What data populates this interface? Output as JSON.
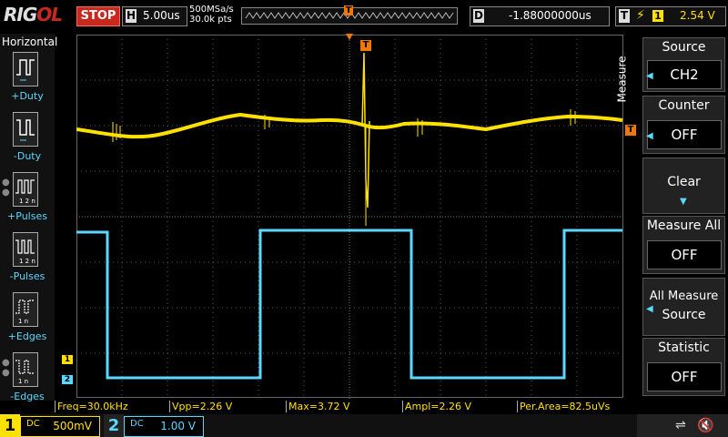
{
  "header": {
    "logo_main": "RIG",
    "logo_accent": "OL",
    "run_state": "STOP",
    "timebase_key": "H",
    "timebase_value": "5.00us",
    "sample_rate": "500MSa/s",
    "memory_depth": "30.0k pts",
    "trigger_marker": "T",
    "delay_key": "D",
    "delay_value": "-1.88000000us",
    "trigger_key": "T",
    "trigger_slope": "⚡",
    "trigger_source": "1",
    "trigger_level": "2.54 V"
  },
  "left_panel": {
    "title": "Horizontal",
    "items": [
      {
        "label": "+Duty",
        "icon": "positive-duty-icon"
      },
      {
        "label": "-Duty",
        "icon": "negative-duty-icon"
      },
      {
        "label": "+Pulses",
        "icon": "positive-pulses-icon"
      },
      {
        "label": "-Pulses",
        "icon": "negative-pulses-icon"
      },
      {
        "label": "+Edges",
        "icon": "positive-edges-icon"
      },
      {
        "label": "-Edges",
        "icon": "negative-edges-icon"
      }
    ]
  },
  "right_panel": {
    "tab_label": "Measure",
    "buttons": [
      {
        "title": "Source",
        "value": "CH2"
      },
      {
        "title": "Counter",
        "value": "OFF"
      },
      {
        "title": "Clear",
        "value": ""
      },
      {
        "title": "Measure All",
        "value": "OFF"
      },
      {
        "title": "All Measure",
        "value": "Source"
      },
      {
        "title": "Statistic",
        "value": "OFF"
      }
    ]
  },
  "markers": {
    "ch1": "1",
    "ch2": "2",
    "trigger_top": "T",
    "trigger_right": "T"
  },
  "measurements": [
    {
      "text": "Freq=30.0kHz"
    },
    {
      "text": "Vpp=2.26 V"
    },
    {
      "text": "Max=3.72 V"
    },
    {
      "text": "Ampl=2.26 V"
    },
    {
      "text": "Per.Area=82.5uVs"
    }
  ],
  "channels": {
    "ch1": {
      "number": "1",
      "coupling": "DC",
      "scale": "500mV",
      "color": "#ffe100"
    },
    "ch2": {
      "number": "2",
      "coupling": "DC",
      "scale": "1.00 V",
      "color": "#5ad8ff"
    }
  },
  "status_icons": [
    "usb-icon",
    "speaker-muted-icon"
  ]
}
